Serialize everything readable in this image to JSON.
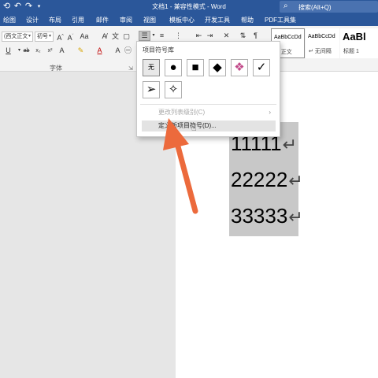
{
  "titlebar": {
    "title": "文档1  -  兼容性模式  -  Word",
    "search_placeholder": "搜索(Alt+Q)",
    "quick_access": [
      "sync-icon",
      "undo-icon",
      "redo-icon"
    ]
  },
  "ribbon_tabs": [
    "绘图",
    "设计",
    "布局",
    "引用",
    "邮件",
    "审阅",
    "视图",
    "模板中心",
    "开发工具",
    "帮助",
    "PDF工具集"
  ],
  "font": {
    "name": "(西文正文",
    "size": "初号",
    "group_label": "字体"
  },
  "styles": [
    {
      "sample": "AaBbCcDd",
      "name": "↵ 正文"
    },
    {
      "sample": "AaBbCcDd",
      "name": "↵ 无间隔"
    },
    {
      "sample": "AaBl",
      "name": "标题 1"
    }
  ],
  "bullet_menu": {
    "title": "项目符号库",
    "symbols": [
      "无",
      "●",
      "■",
      "◆",
      "❖",
      "✓",
      "➢",
      "✧"
    ],
    "change_level": "更改列表级别(C)",
    "define_new": "定义新项目符号(D)..."
  },
  "document": {
    "lines": [
      "11111",
      "22222",
      "33333"
    ],
    "para_mark": "↵"
  },
  "colors": {
    "titlebar": "#2b579a",
    "annotation_arrow": "#ec6a3c"
  }
}
